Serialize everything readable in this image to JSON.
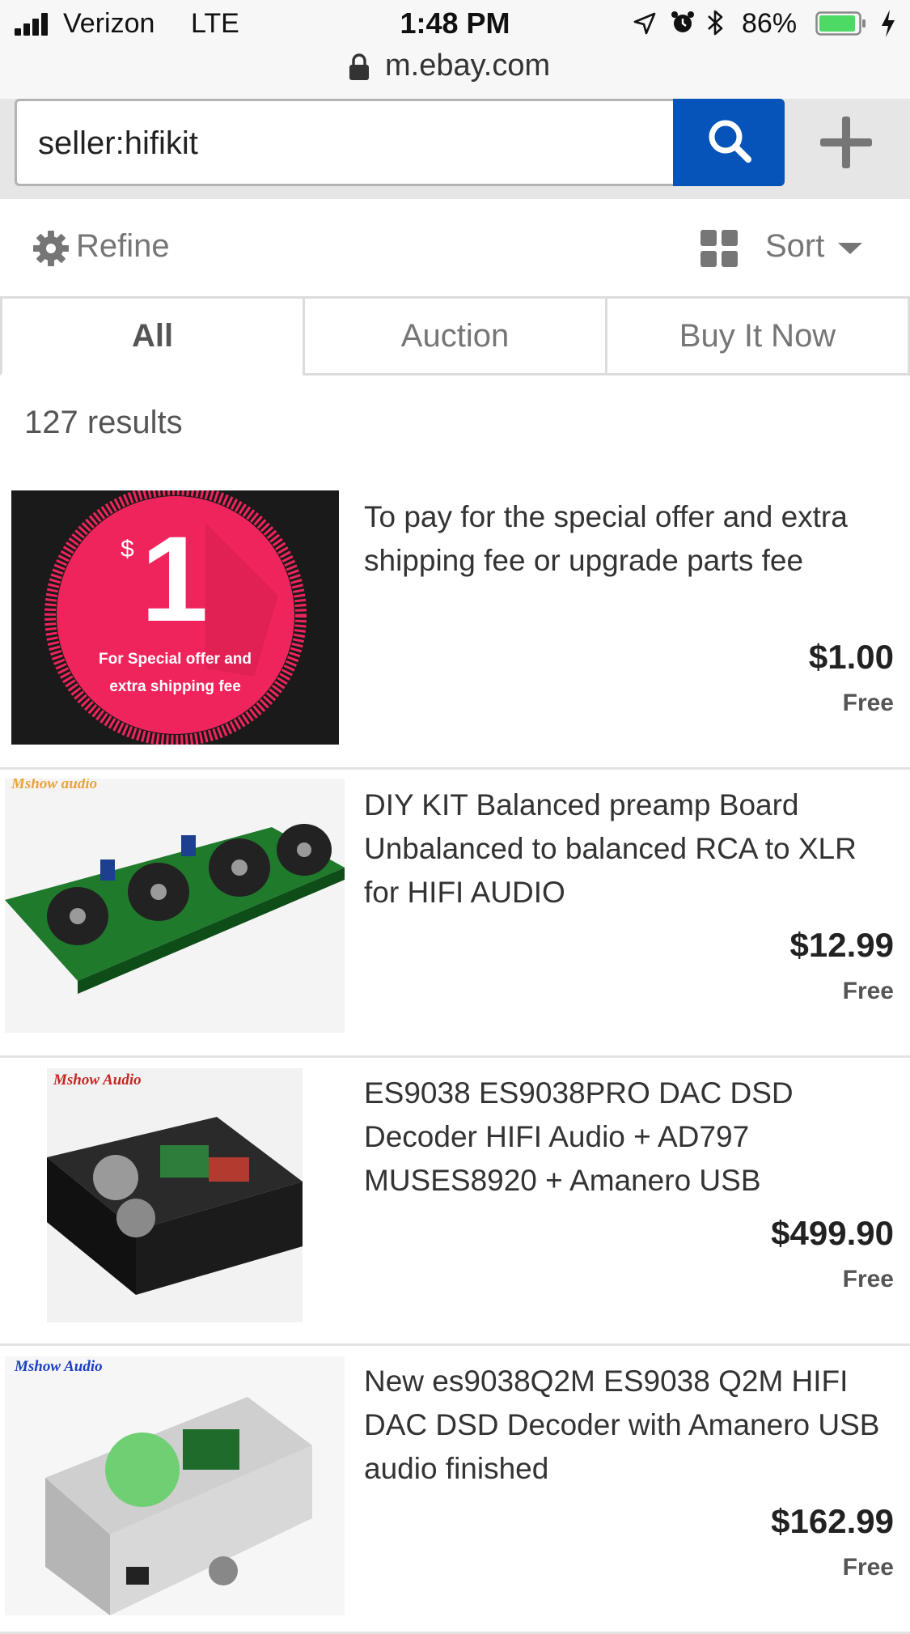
{
  "status_bar": {
    "carrier": "Verizon",
    "network": "LTE",
    "time": "1:48 PM",
    "battery_percent": "86%",
    "icons": [
      "signal-icon",
      "location-arrow-icon",
      "alarm-icon",
      "bluetooth-icon",
      "battery-icon",
      "charging-bolt-icon"
    ]
  },
  "browser": {
    "url": "m.ebay.com"
  },
  "search": {
    "query": "seller:hifikit"
  },
  "toolbar": {
    "refine_label": "Refine",
    "sort_label": "Sort"
  },
  "tabs": [
    {
      "label": "All",
      "active": true
    },
    {
      "label": "Auction",
      "active": false
    },
    {
      "label": "Buy It Now",
      "active": false
    }
  ],
  "results": {
    "count_label": "127 results"
  },
  "listings": [
    {
      "title": "To pay for the special offer and extra shipping fee or upgrade parts fee",
      "price": "$1.00",
      "shipping": "Free",
      "image": {
        "currency": "$",
        "big_number": "1",
        "caption_line1": "For Special offer and",
        "caption_line2": "extra shipping fee"
      }
    },
    {
      "title": "DIY KIT Balanced preamp Board Unbalanced to balanced RCA to XLR for HIFI AUDIO",
      "price": "$12.99",
      "shipping": "Free",
      "image": {
        "watermark": "Mshow audio"
      }
    },
    {
      "title": "ES9038 ES9038PRO DAC DSD Decoder HIFI Audio + AD797 MUSES8920 + Amanero USB",
      "price": "$499.90",
      "shipping": "Free",
      "image": {
        "watermark": "Mshow Audio"
      }
    },
    {
      "title": "New es9038Q2M ES9038 Q2M HIFI DAC DSD Decoder with Amanero USB audio finished",
      "price": "$162.99",
      "shipping": "Free",
      "image": {
        "watermark": "Mshow Audio"
      }
    }
  ],
  "colors": {
    "search_blue": "#0654ba",
    "promo_pink": "#f0245c",
    "pcb_green": "#1f7a2c"
  }
}
